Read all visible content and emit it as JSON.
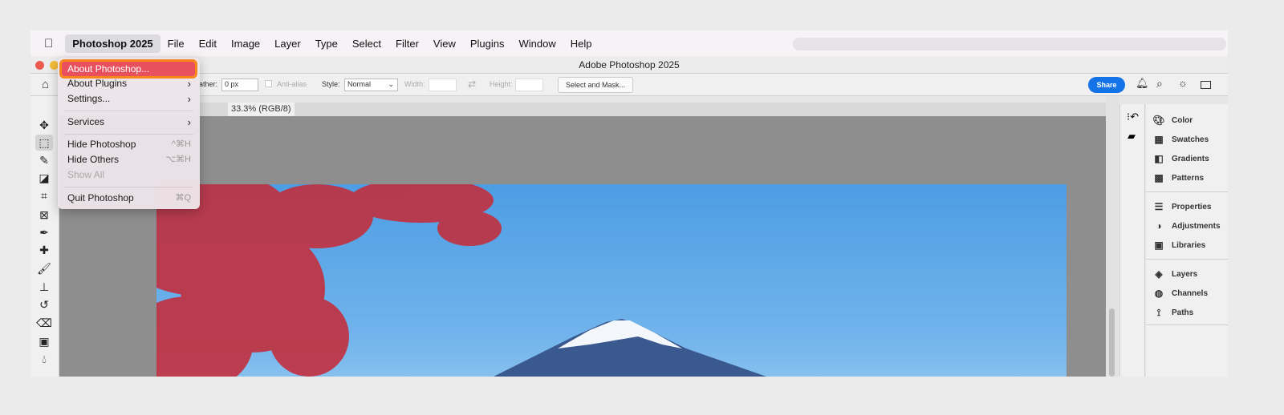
{
  "menubar": {
    "apple": "",
    "app": "Photoshop 2025",
    "items": [
      "File",
      "Edit",
      "Image",
      "Layer",
      "Type",
      "Select",
      "Filter",
      "View",
      "Plugins",
      "Window",
      "Help"
    ]
  },
  "window": {
    "title": "Adobe Photoshop 2025"
  },
  "options": {
    "feather_label": "ather:",
    "feather_value": "0 px",
    "antialias": "Anti-alias",
    "style_label": "Style:",
    "style_value": "Normal",
    "width_label": "Width:",
    "height_label": "Height:",
    "select_mask": "Select and Mask...",
    "share": "Share"
  },
  "document": {
    "tab": "33.3% (RGB/8)"
  },
  "app_menu": {
    "about": "About Photoshop...",
    "plugins": "About Plugins",
    "settings": "Settings...",
    "services": "Services",
    "hide": "Hide Photoshop",
    "hide_sc": "^⌘H",
    "hide_others": "Hide Others",
    "hide_others_sc": "⌥⌘H",
    "show_all": "Show All",
    "quit": "Quit Photoshop",
    "quit_sc": "⌘Q"
  },
  "panels": {
    "group1": [
      "Color",
      "Swatches",
      "Gradients",
      "Patterns"
    ],
    "group2": [
      "Properties",
      "Adjustments",
      "Libraries"
    ],
    "group3": [
      "Layers",
      "Channels",
      "Paths"
    ]
  },
  "colors": {
    "highlight": "#e7505c",
    "outline": "#f7871c",
    "share": "#1473e6"
  }
}
